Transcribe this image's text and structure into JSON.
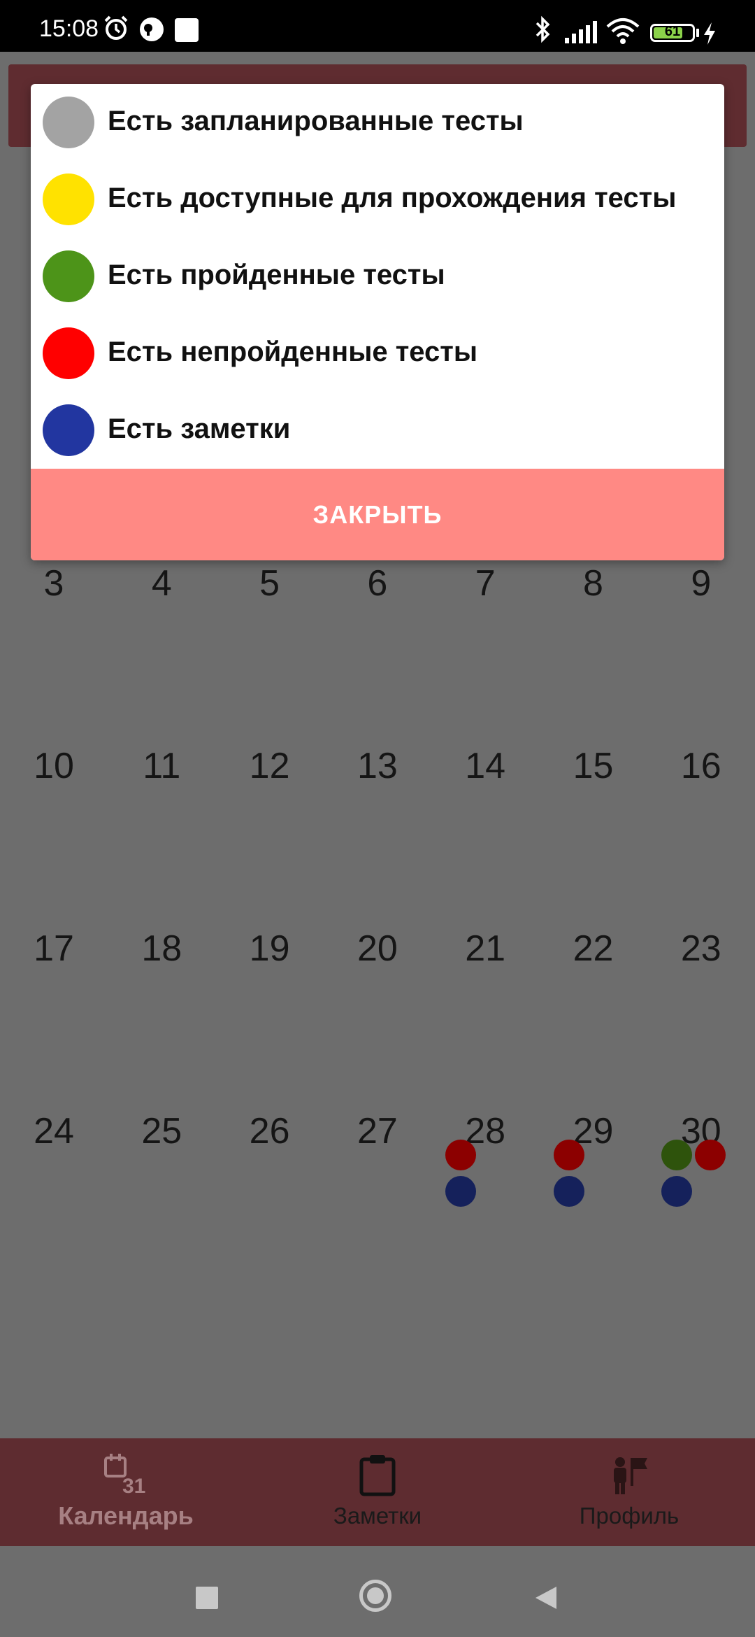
{
  "status_bar": {
    "time": "15:08",
    "battery_level": "61",
    "icons": [
      "alarm-icon",
      "app-notification-icon",
      "blank-notification-icon",
      "bluetooth-icon",
      "signal-icon",
      "wifi-icon",
      "battery-icon",
      "charging-icon"
    ]
  },
  "legend": {
    "items": [
      {
        "label": "Есть запланированные тесты",
        "color": "#a3a3a3"
      },
      {
        "label": "Есть доступные для прохождения тесты",
        "color": "#ffe200"
      },
      {
        "label": "Есть пройденные тесты",
        "color": "#4d9419"
      },
      {
        "label": "Есть непройденные тесты",
        "color": "#ff0000"
      },
      {
        "label": "Есть заметки",
        "color": "#2236a0"
      }
    ],
    "close_label": "ЗАКРЫТЬ",
    "close_color": "#ff8984"
  },
  "calendar": {
    "weeks": [
      [
        "3",
        "4",
        "5",
        "6",
        "7",
        "8",
        "9"
      ],
      [
        "10",
        "11",
        "12",
        "13",
        "14",
        "15",
        "16"
      ],
      [
        "17",
        "18",
        "19",
        "20",
        "21",
        "22",
        "23"
      ],
      [
        "24",
        "25",
        "26",
        "27",
        "28",
        "29",
        "30"
      ]
    ],
    "markers": [
      {
        "day": "28",
        "dots": [
          "failed",
          "notes"
        ]
      },
      {
        "day": "29",
        "dots": [
          "failed",
          "notes"
        ]
      },
      {
        "day": "30",
        "dots": [
          "passed",
          "failed",
          "notes"
        ]
      }
    ]
  },
  "bottom_nav": {
    "items": [
      {
        "label": "Календарь",
        "icon": "calendar-icon",
        "active": true
      },
      {
        "label": "Заметки",
        "icon": "clipboard-icon",
        "active": false
      },
      {
        "label": "Профиль",
        "icon": "profile-flag-icon",
        "active": false
      }
    ]
  },
  "system_nav": {
    "icons": [
      "recents-square-icon",
      "home-circle-icon",
      "back-triangle-icon"
    ]
  },
  "colors": {
    "header": "#5f2c30",
    "bottom_nav": "#5e2c30",
    "scrim_background": "#6d6d6d"
  }
}
